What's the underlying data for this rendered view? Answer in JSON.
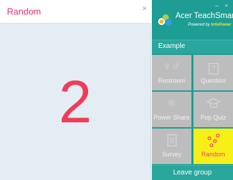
{
  "left_window": {
    "title": "Random",
    "close_glyph": "×",
    "result_number": "2"
  },
  "app": {
    "brand_title": "Acer TeachSmart",
    "powered_by": "Powered by",
    "powered_brand": "InfoPower",
    "window_controls": "– ×",
    "section_label": "Example",
    "tiles": [
      {
        "label": "Restroom",
        "icon": "restroom-icon",
        "glyph": "♀♂"
      },
      {
        "label": "Question",
        "icon": "question-icon",
        "glyph": "?"
      },
      {
        "label": "Power Share",
        "icon": "power-share-icon",
        "glyph": "⚛"
      },
      {
        "label": "Pop Quiz",
        "icon": "graduation-cap-icon",
        "glyph": "🎓"
      },
      {
        "label": "Survey",
        "icon": "survey-icon",
        "glyph": "▤"
      },
      {
        "label": "Random",
        "icon": "random-dots-icon",
        "glyph": ""
      }
    ],
    "leave_label": "Leave group"
  },
  "colors": {
    "teal": "#1d9d93",
    "accent_pink": "#e8346f",
    "number_red": "#ef3d59",
    "tile_gray": "#bdbdbd",
    "random_yellow": "#f7f017"
  }
}
